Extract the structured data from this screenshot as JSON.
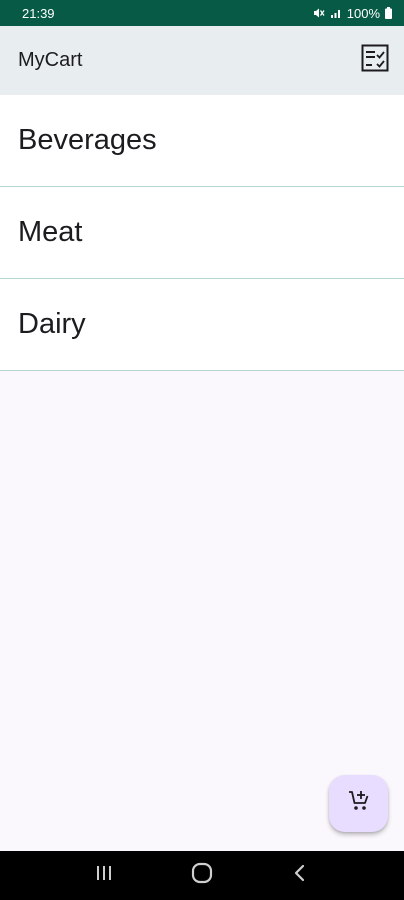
{
  "status_bar": {
    "time": "21:39",
    "battery": "100%",
    "icons": [
      "mute-icon",
      "signal-icon",
      "battery-icon"
    ]
  },
  "app_bar": {
    "title": "MyCart",
    "action_icon": "checklist-icon"
  },
  "categories": [
    {
      "label": "Beverages"
    },
    {
      "label": "Meat"
    },
    {
      "label": "Dairy"
    }
  ],
  "fab": {
    "icon": "add-shopping-cart-icon"
  },
  "nav_bar": {
    "buttons": [
      "recent-apps-icon",
      "home-icon",
      "back-icon"
    ]
  },
  "colors": {
    "status_bar": "#075a45",
    "app_bar": "#e8eef0",
    "background": "#fbf8fd",
    "divider": "#b7d6cf",
    "fab": "#e9ddff"
  }
}
